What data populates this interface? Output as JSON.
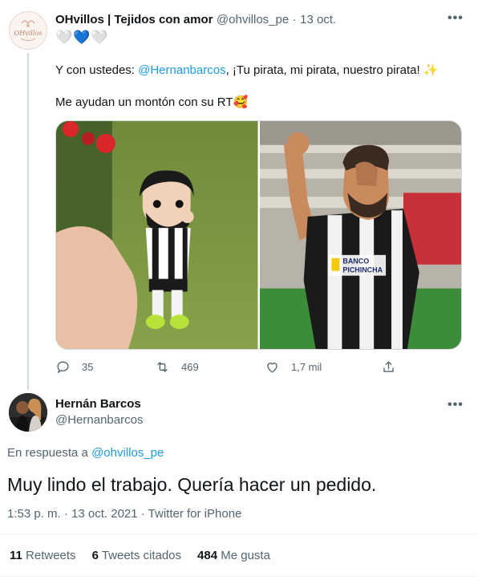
{
  "tweet1": {
    "display_name": "OHvillos | Tejidos con amor",
    "handle": "@ohvillos_pe",
    "separator": "·",
    "date": "13 oct.",
    "avatar_text": "OHvillos",
    "hearts": [
      "🤍",
      "💙",
      "🤍"
    ],
    "line1_prefix": "Y con ustedes: ",
    "line1_mention": "@Hernanbarcos",
    "line1_suffix": ", ¡Tu pirata, mi pirata, nuestro pirata! ✨",
    "line2": "Me ayudan un montón con su RT🥰",
    "actions": {
      "reply_count": "35",
      "retweet_count": "469",
      "like_count": "1,7 mil"
    },
    "photo2_banner_line1": "BANCO",
    "photo2_banner_line2": "PICHINCHA"
  },
  "tweet2": {
    "display_name": "Hernán Barcos",
    "handle": "@Hernanbarcos",
    "reply_prefix": "En respuesta a ",
    "reply_mention": "@ohvillos_pe",
    "text": "Muy lindo el trabajo. Quería hacer un pedido.",
    "meta": "1:53 p. m. · 13 oct. 2021 · Twitter for iPhone",
    "stats": {
      "retweets_count": "11",
      "retweets_label": "Retweets",
      "quotes_count": "6",
      "quotes_label": "Tweets citados",
      "likes_count": "484",
      "likes_label": "Me gusta"
    }
  },
  "icons": {
    "more": "more-icon",
    "reply": "reply-icon",
    "retweet": "retweet-icon",
    "like": "like-icon",
    "share": "share-icon"
  }
}
